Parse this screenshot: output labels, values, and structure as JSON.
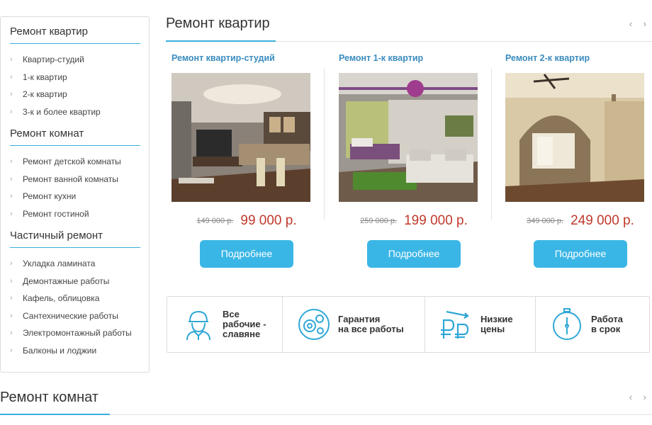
{
  "sidebar": {
    "groups": [
      {
        "heading": "Ремонт квартир",
        "items": [
          "Квартир-студий",
          "1-к квартир",
          "2-к квартир",
          "3-к и более квартир"
        ]
      },
      {
        "heading": "Ремонт комнат",
        "items": [
          "Ремонт детской комнаты",
          "Ремонт ванной комнаты",
          "Ремонт кухни",
          "Ремонт гостиной"
        ]
      },
      {
        "heading": "Частичный ремонт",
        "items": [
          "Укладка ламината",
          "Демонтажные работы",
          "Кафель, облицовка",
          "Сантехнические работы",
          "Электромонтажный работы",
          "Балконы и лоджии"
        ]
      }
    ]
  },
  "section1": {
    "title": "Ремонт квартир",
    "arrows": "‹ ›"
  },
  "cards": [
    {
      "title": "Ремонт квартир-студий",
      "old_price": "149 000 р.",
      "new_price": "99 000 р.",
      "button": "Подробнее"
    },
    {
      "title": "Ремонт 1-к квартир",
      "old_price": "259 000 р.",
      "new_price": "199 000 р.",
      "button": "Подробнее"
    },
    {
      "title": "Ремонт 2-к квартир",
      "old_price": "349 000 р.",
      "new_price": "249 000 р.",
      "button": "Подробнее"
    }
  ],
  "features": [
    {
      "icon": "worker-icon",
      "text": "Все\nрабочие -\nславяне"
    },
    {
      "icon": "gears-icon",
      "text": "Гарантия\nна все работы"
    },
    {
      "icon": "ruble-icon",
      "text": "Низкие\nцены"
    },
    {
      "icon": "stopwatch-icon",
      "text": "Работа\nв срок"
    }
  ],
  "section2": {
    "title": "Ремонт комнат",
    "arrows": "‹ ›"
  },
  "colors": {
    "accent": "#3aaee0",
    "button": "#3ab6e6",
    "price": "#c0392b",
    "link": "#3a8bbf"
  }
}
